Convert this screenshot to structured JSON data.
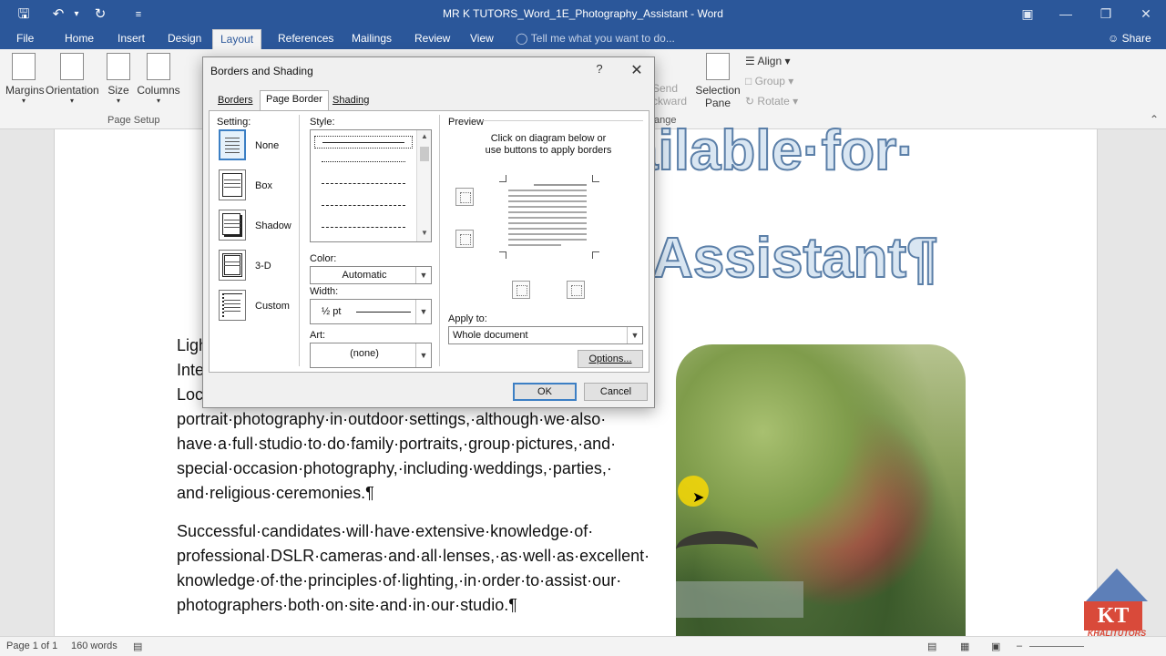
{
  "window": {
    "title": "MR K TUTORS_Word_1E_Photography_Assistant - Word",
    "quick_access": [
      "save-icon",
      "undo-icon",
      "redo-icon",
      "customize-icon"
    ]
  },
  "ribbon": {
    "tabs": [
      "File",
      "Home",
      "Insert",
      "Design",
      "Layout",
      "References",
      "Mailings",
      "Review",
      "View"
    ],
    "active_tab": "Layout",
    "tell_me": "Tell me what you want to do...",
    "share": "Share",
    "page_setup": {
      "margins": "Margins",
      "orientation": "Orientation",
      "size": "Size",
      "columns": "Columns",
      "group_label": "Page Setup"
    },
    "arrange": {
      "send_backward_1": "Send",
      "send_backward_2": "ckward",
      "selection_pane_1": "Selection",
      "selection_pane_2": "Pane",
      "align": "Align",
      "group": "Group",
      "rotate": "Rotate",
      "group_label": "ange"
    }
  },
  "document": {
    "heading_word_1": "ailable·for·",
    "heading_word_2": "Assistant¶",
    "para_fragments": [
      "Ligh",
      "Inte",
      "Loca"
    ],
    "para1_lines": [
      "portrait·photography·in·outdoor·settings,·although·we·also·",
      "have·a·full·studio·to·do·family·portraits,·group·pictures,·and·",
      "special·occasion·photography,·including·weddings,·parties,·",
      "and·religious·ceremonies.¶"
    ],
    "para2_lines": [
      "Successful·candidates·will·have·extensive·knowledge·of·",
      "professional·DSLR·cameras·and·all·lenses,·as·well·as·excellent·",
      "knowledge·of·the·principles·of·lighting,·in·order·to·assist·our·",
      "photographers·both·on·site·and·in·our·studio.¶"
    ]
  },
  "dialog": {
    "title": "Borders and Shading",
    "help": "?",
    "tabs": [
      "Borders",
      "Page Border",
      "Shading"
    ],
    "selected_tab": "Page Border",
    "setting_label": "Setting:",
    "settings": [
      "None",
      "Box",
      "Shadow",
      "3-D",
      "Custom"
    ],
    "selected_setting": "None",
    "style_label": "Style:",
    "color_label": "Color:",
    "color_value": "Automatic",
    "width_label": "Width:",
    "width_value": "½ pt",
    "art_label": "Art:",
    "art_value": "(none)",
    "preview_label": "Preview",
    "preview_hint_1": "Click on diagram below or",
    "preview_hint_2": "use buttons to apply borders",
    "apply_to_label": "Apply to:",
    "apply_to_value": "Whole document",
    "options_button": "Options...",
    "ok_button": "OK",
    "cancel_button": "Cancel"
  },
  "status": {
    "page": "Page 1 of 1",
    "words": "160 words"
  },
  "logo": {
    "letters": "KT",
    "brand": "KHALITUTORS"
  },
  "colors": {
    "title_bar": "#2b579a",
    "ribbon_bg": "#f3f3f3",
    "accent": "#3c7fc4",
    "heading_fill": "#d9e6f2",
    "heading_stroke": "#5b7fa8"
  }
}
